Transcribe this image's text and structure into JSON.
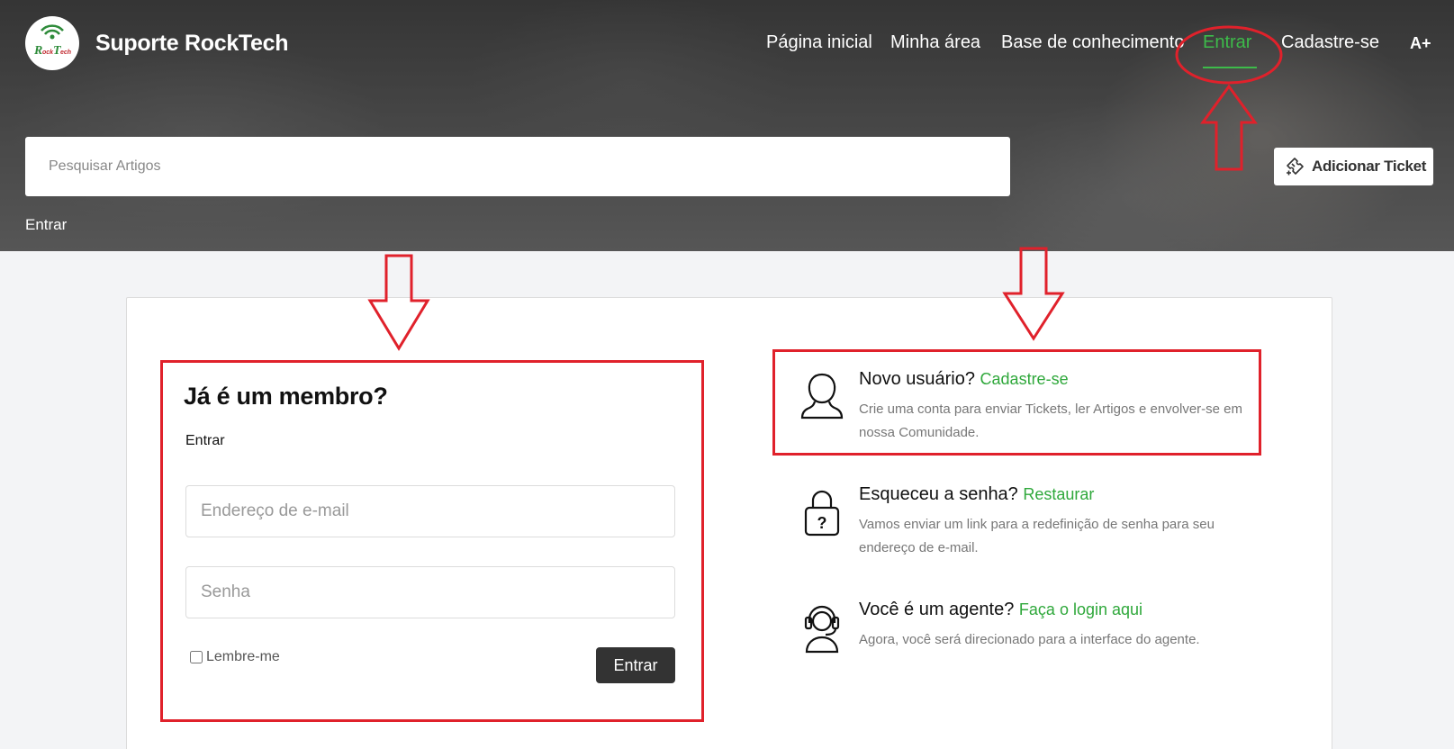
{
  "header": {
    "brand": "Suporte RockTech",
    "nav": {
      "home": "Página inicial",
      "my_area": "Minha área",
      "knowledge_base": "Base de conhecimento",
      "login": "Entrar",
      "signup": "Cadastre-se",
      "font_size": "A+"
    },
    "search_placeholder": "Pesquisar Artigos",
    "add_ticket": "Adicionar Ticket",
    "breadcrumb": "Entrar"
  },
  "login_panel": {
    "title": "Já é um membro?",
    "subtitle": "Entrar",
    "email_placeholder": "Endereço de e-mail",
    "password_placeholder": "Senha",
    "remember_label": "Lembre-me",
    "submit_label": "Entrar"
  },
  "info": {
    "new_user": {
      "title": "Novo usuário?",
      "link": "Cadastre-se",
      "desc": "Crie uma conta para enviar Tickets, ler Artigos e envolver-se em nossa Comunidade."
    },
    "forgot": {
      "title": "Esqueceu a senha?",
      "link": "Restaurar",
      "desc": "Vamos enviar um link para a redefinição de senha para seu endereço de e-mail."
    },
    "agent": {
      "title": "Você é um agente?",
      "link": "Faça o login aqui",
      "desc": "Agora, você será direcionado para a interface do agente."
    }
  },
  "colors": {
    "accent": "#3dbb4a",
    "annotation": "#e0212b",
    "button_dark": "#333333"
  }
}
